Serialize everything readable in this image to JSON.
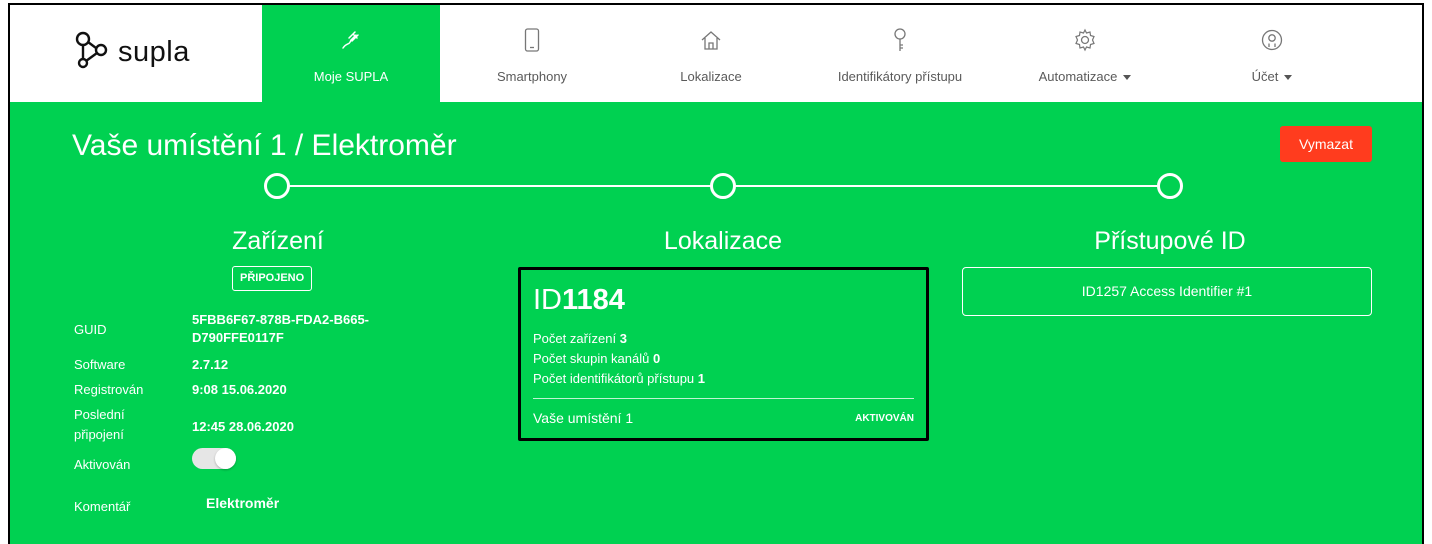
{
  "brand": {
    "name": "supla",
    "icon": "supla-logo-icon"
  },
  "nav": {
    "items": [
      {
        "label": "Moje SUPLA",
        "icon": "plug-icon",
        "active": true
      },
      {
        "label": "Smartphony",
        "icon": "smartphone-icon"
      },
      {
        "label": "Lokalizace",
        "icon": "home-icon"
      },
      {
        "label": "Identifikátory přístupu",
        "icon": "key-icon"
      },
      {
        "label": "Automatizace",
        "icon": "gear-icon",
        "dropdown": true
      },
      {
        "label": "Účet",
        "icon": "user-icon",
        "dropdown": true
      }
    ]
  },
  "page": {
    "title": "Vaše umístění 1 / Elektroměr",
    "delete_label": "Vymazat"
  },
  "columns": {
    "device": "Zařízení",
    "location": "Lokalizace",
    "access": "Přístupové ID"
  },
  "device": {
    "status": "PŘIPOJENO",
    "guid_label": "GUID",
    "guid_line1": "5FBB6F67-878B-FDA2-B665-",
    "guid_line2": "D790FFE0117F",
    "software_label": "Software",
    "software_value": "2.7.12",
    "registered_label": "Registrován",
    "registered_value": "9:08 15.06.2020",
    "last_conn_label_1": "Poslední",
    "last_conn_label_2": "připojení",
    "last_conn_value": "12:45 28.06.2020",
    "active_label": "Aktivován",
    "active": true,
    "comment_label": "Komentář",
    "comment_value": "Elektroměr"
  },
  "location": {
    "id_prefix": "ID",
    "id_number": "1184",
    "devices_label": "Počet zařízení",
    "devices_count": "3",
    "channel_groups_label": "Počet skupin kanálů",
    "channel_groups_count": "0",
    "access_ids_label": "Počet identifikátorů přístupu",
    "access_ids_count": "1",
    "name": "Vaše umístění 1",
    "status": "AKTIVOVÁN"
  },
  "access": {
    "label": "ID1257 Access Identifier #1"
  },
  "colors": {
    "brand_green": "#00d151",
    "danger": "#ff3c1e",
    "text_light": "#ffffff"
  }
}
